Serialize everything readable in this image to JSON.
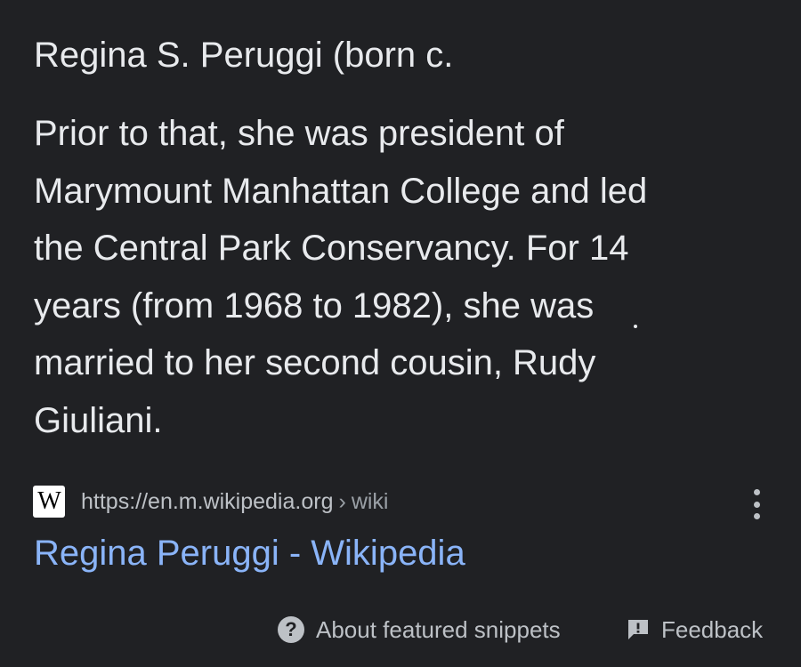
{
  "snippet": {
    "lead": "Regina S. Peruggi (born c.",
    "lines": [
      "Prior to that, she was president of",
      "Marymount Manhattan College and led",
      "the Central Park Conservancy. For 14",
      "years (from 1968 to 1982), she was",
      "married to her second cousin, Rudy",
      "Giuliani."
    ]
  },
  "source": {
    "favicon_letter": "W",
    "url": "https://en.m.wikipedia.org",
    "separator": "›",
    "breadcrumb": "wiki",
    "title": "Regina Peruggi - Wikipedia"
  },
  "footer": {
    "about_label": "About featured snippets",
    "feedback_label": "Feedback",
    "about_icon_glyph": "?"
  },
  "colors": {
    "background": "#202124",
    "text": "#e8eaed",
    "link": "#8ab4f8",
    "muted": "#bdc1c6"
  },
  "icons": {
    "source_favicon": "wikipedia-icon",
    "menu": "more-vert-icon",
    "about": "help-circle-icon",
    "feedback": "feedback-icon"
  }
}
